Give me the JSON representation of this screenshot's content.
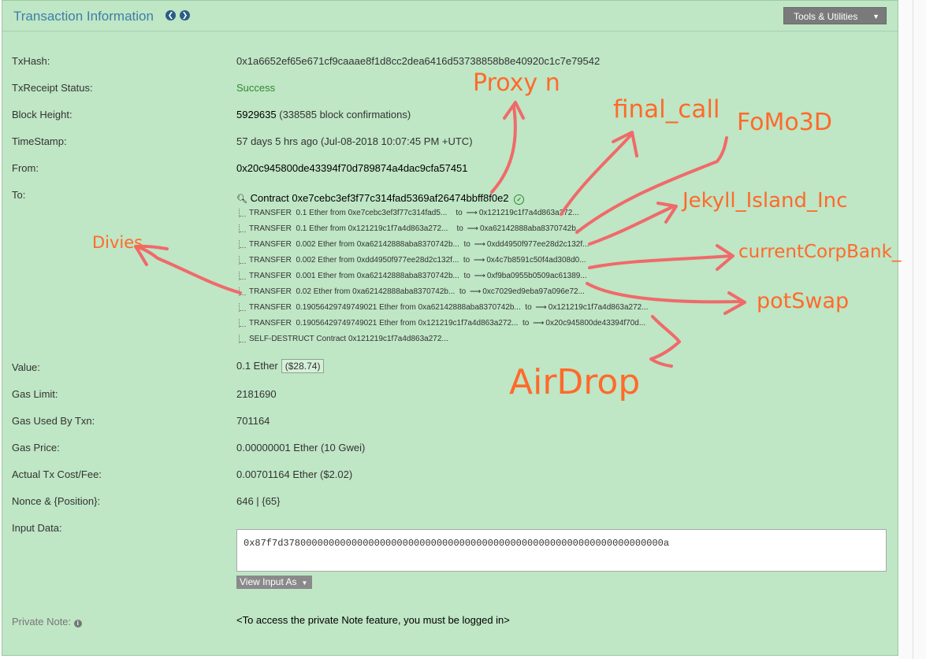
{
  "header": {
    "title": "Transaction Information",
    "tools_label": "Tools & Utilities"
  },
  "fields": {
    "txhash": {
      "label": "TxHash:",
      "value": "0x1a6652ef65e671cf9caaae8f1d8cc2dea6416d53738858b8e40920c1c7e79542"
    },
    "status": {
      "label": "TxReceipt Status:",
      "value": "Success"
    },
    "block": {
      "label": "Block Height:",
      "value": "5929635",
      "extra": "(338585 block confirmations)"
    },
    "timestamp": {
      "label": "TimeStamp:",
      "value": "57 days 5 hrs ago (Jul-08-2018 10:07:45 PM +UTC)"
    },
    "from": {
      "label": "From:",
      "value": "0x20c945800de43394f70d789874a4dac9cfa57451"
    },
    "to": {
      "label": "To:",
      "prefix": "Contract",
      "value": "0xe7cebc3ef3f77c314fad5369af26474bbff8f0e2"
    },
    "value": {
      "label": "Value:",
      "value": "0.1 Ether",
      "usd": "($28.74)"
    },
    "gas_limit": {
      "label": "Gas Limit:",
      "value": "2181690"
    },
    "gas_used": {
      "label": "Gas Used By Txn:",
      "value": "701164"
    },
    "gas_price": {
      "label": "Gas Price:",
      "value": "0.00000001 Ether (10 Gwei)"
    },
    "fee": {
      "label": "Actual Tx Cost/Fee:",
      "value": "0.00701164 Ether ($2.02)"
    },
    "nonce": {
      "label": "Nonce & {Position}:",
      "value": "646 | {65}"
    },
    "input": {
      "label": "Input Data:",
      "value": "0x87f7d3780000000000000000000000000000000000000000000000000000000000000000a",
      "view_as": "View Input As"
    },
    "private_note": {
      "label": "Private Note:",
      "value": "<To access the private Note feature, you must be logged in>"
    }
  },
  "transfers": [
    {
      "type": "TRANSFER",
      "amount": "0.1 Ether from",
      "from": "0xe7cebc3ef3f77c314fad5...",
      "to_label": "to",
      "to": "0x121219c1f7a4d863a272..."
    },
    {
      "type": "TRANSFER",
      "amount": "0.1 Ether from",
      "from": "0x121219c1f7a4d863a272...",
      "to_label": "to",
      "to": "0xa62142888aba8370742b..."
    },
    {
      "type": "TRANSFER",
      "amount": "0.002 Ether from",
      "from": "0xa62142888aba8370742b...",
      "to_label": "to",
      "to": "0xdd4950f977ee28d2c132f..."
    },
    {
      "type": "TRANSFER",
      "amount": "0.002 Ether from",
      "from": "0xdd4950f977ee28d2c132f...",
      "to_label": "to",
      "to": "0x4c7b8591c50f4ad308d0..."
    },
    {
      "type": "TRANSFER",
      "amount": "0.001 Ether from",
      "from": "0xa62142888aba8370742b...",
      "to_label": "to",
      "to": "0xf9ba0955b0509ac61389..."
    },
    {
      "type": "TRANSFER",
      "amount": "0.02 Ether from",
      "from": "0xa62142888aba8370742b...",
      "to_label": "to",
      "to": "0xc7029ed9eba97a096e72..."
    },
    {
      "type": "TRANSFER",
      "amount": "0.19056429749749021 Ether from",
      "from": "0xa62142888aba8370742b...",
      "to_label": "to",
      "to": "0x121219c1f7a4d863a272..."
    },
    {
      "type": "TRANSFER",
      "amount": "0.19056429749749021 Ether from",
      "from": "0x121219c1f7a4d863a272...",
      "to_label": "to",
      "to": "0x20c945800de43394f70d..."
    }
  ],
  "self_destruct": {
    "type": "SELF-DESTRUCT",
    "label": "Contract",
    "address": "0x121219c1f7a4d863a272..."
  },
  "annotations": {
    "proxy": "Proxy n",
    "final_call": "final_call",
    "fomo3d": "FoMo3D",
    "jekyll": "Jekyll_Island_Inc",
    "corp_bank": "currentCorpBank_",
    "pot_swap": "potSwap",
    "divies": "Divies",
    "airdrop": "AirDrop"
  },
  "colors": {
    "panel": "#bfe6c5",
    "annotation_text": "#ff6a2b",
    "annotation_arrow": "#f06a6a",
    "title": "#3d7fa8",
    "success": "#2f8a2f"
  },
  "icons": {
    "nav_prev": "chevron-left-icon",
    "nav_next": "chevron-right-icon",
    "contract": "magnifier-icon",
    "verified": "check-circle-icon",
    "info": "info-icon"
  }
}
